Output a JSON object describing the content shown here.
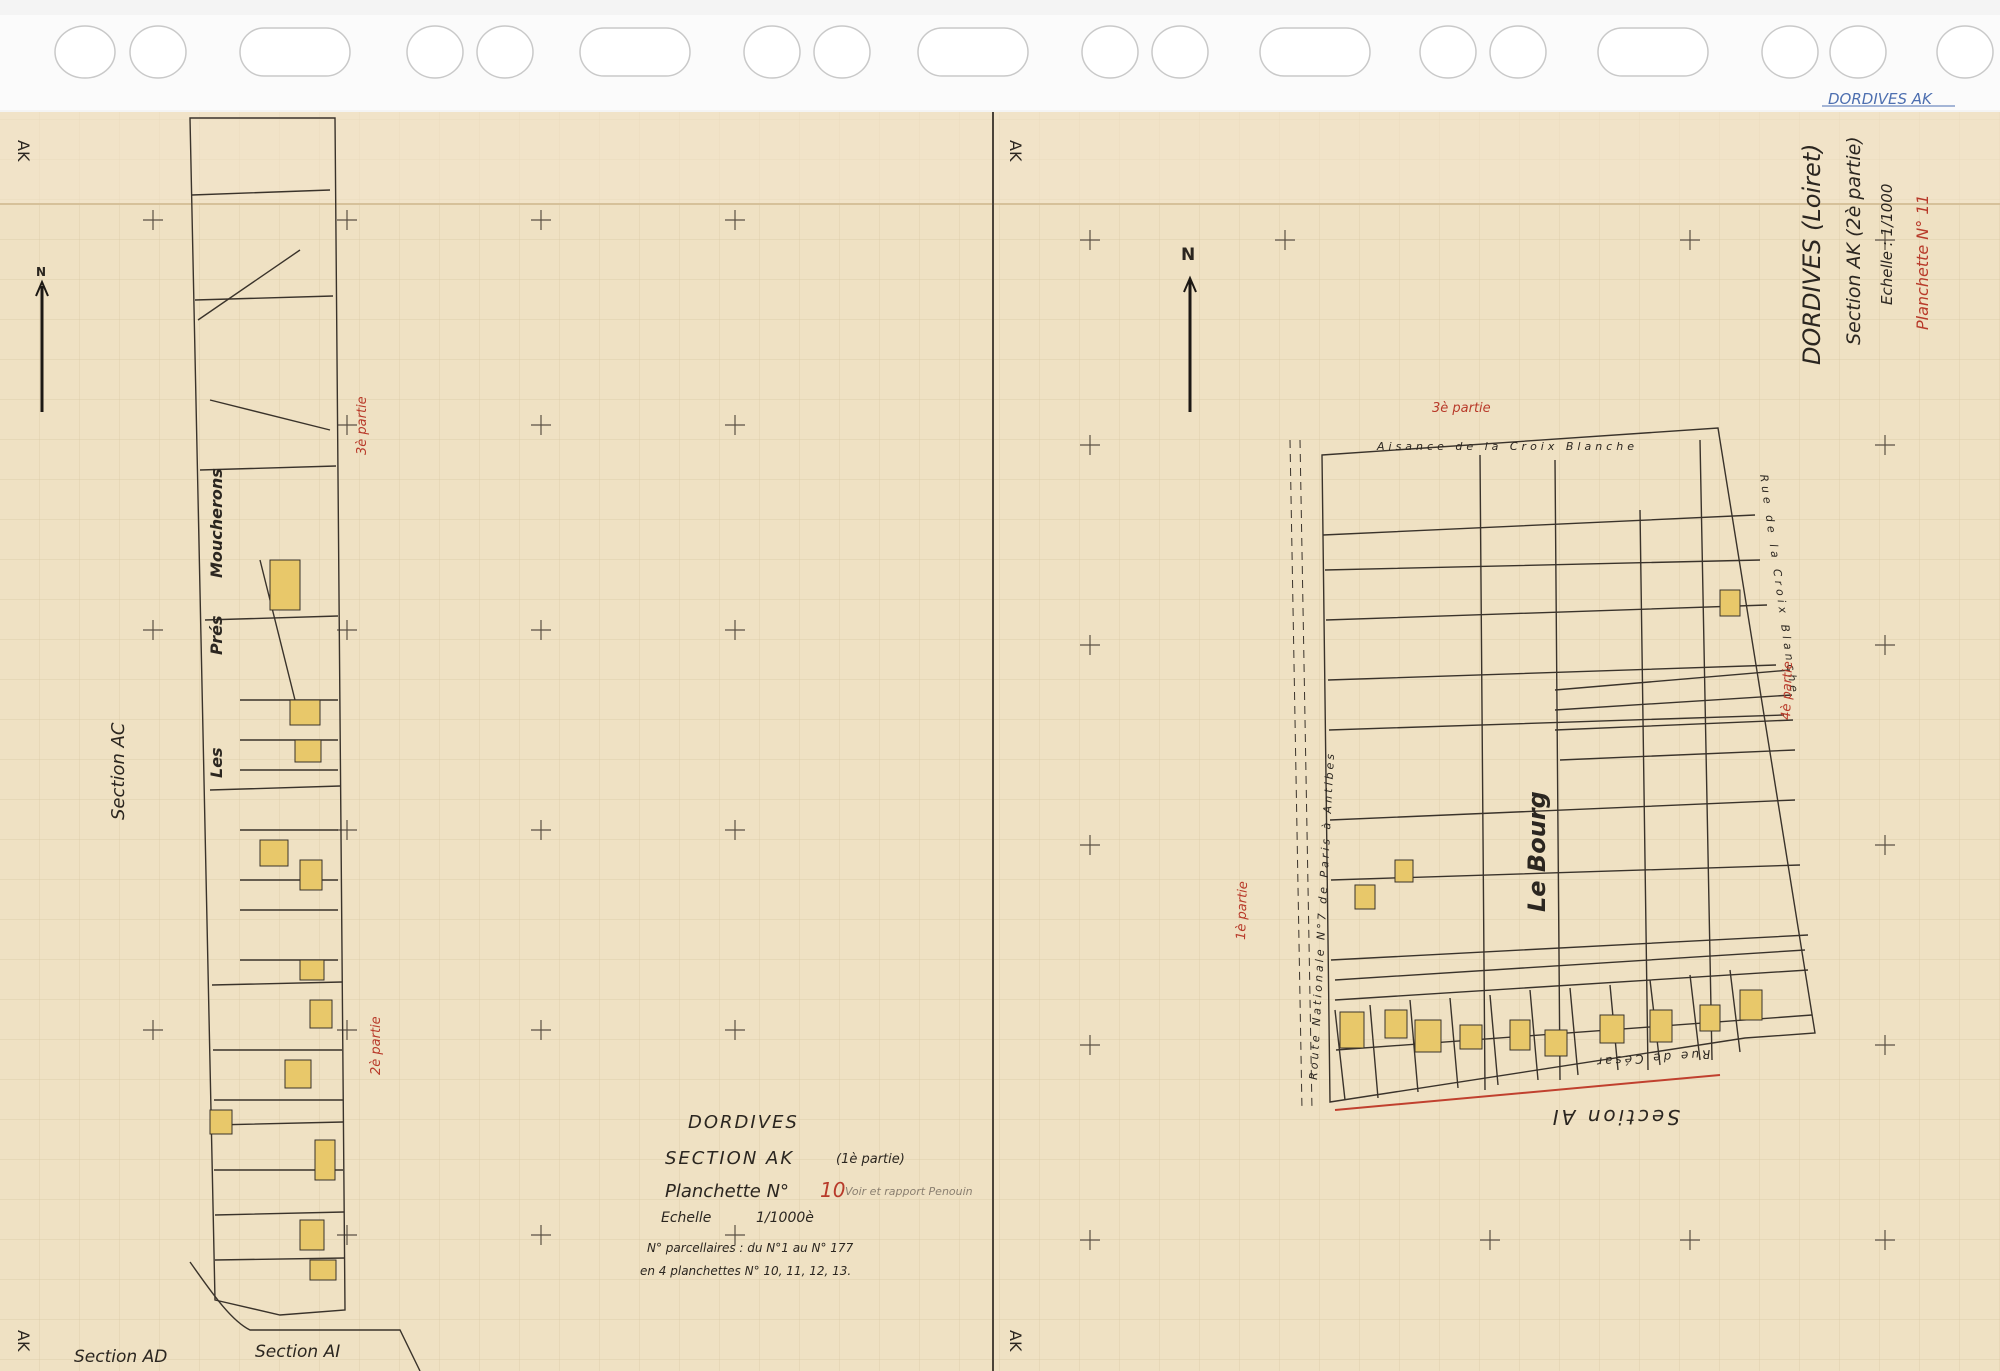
{
  "sheet_header_label": "DORDIVES AK",
  "left_sheet": {
    "title": "DORDIVES",
    "section": "SECTION AK",
    "section_part": "(1è partie)",
    "planchette_label": "Planchette N°",
    "planchette_number": "10",
    "planchette_note": "Voir et rapport Penouin",
    "scale_label": "Echelle",
    "scale_value": "1/1000è",
    "parcels_line": "N° parcellaires : du N°1 au N° 177",
    "planchettes_line": "en 4 planchettes N° 10, 11, 12, 13.",
    "north_label": "N",
    "place_words": [
      "Les",
      "Prés",
      "Moucherons"
    ],
    "section_ac": "Section AC",
    "section_ad": "Section AD",
    "section_ai": "Section AI",
    "partie_3": "3è partie",
    "partie_2": "2è partie",
    "margin_ak": "AK"
  },
  "right_sheet": {
    "title": "DORDIVES (Loiret)",
    "section": "Section AK (2è partie)",
    "scale": "Echelle : 1/1000",
    "planchette": "Planchette N° 11",
    "north_label": "N",
    "place_name": "Le Bourg",
    "aisance": "Aisance de la Croix Blanche",
    "route": "Route Nationale N°7 de Paris à Antibes",
    "rue_croix_blanche": "Rue de la Croix Blanche",
    "rue_cesar": "Rue de César",
    "section_ai": "Section AI",
    "partie_1": "1è partie",
    "partie_3": "3è partie",
    "partie_4": "4è partie",
    "margin_ak": "AK"
  },
  "colors": {
    "paper": "#efe1c3",
    "ink": "#2b2620",
    "red_numbers": "#b83a2a",
    "building_fill": "#e8c86a",
    "annotation_blue": "#4d6fb0"
  }
}
